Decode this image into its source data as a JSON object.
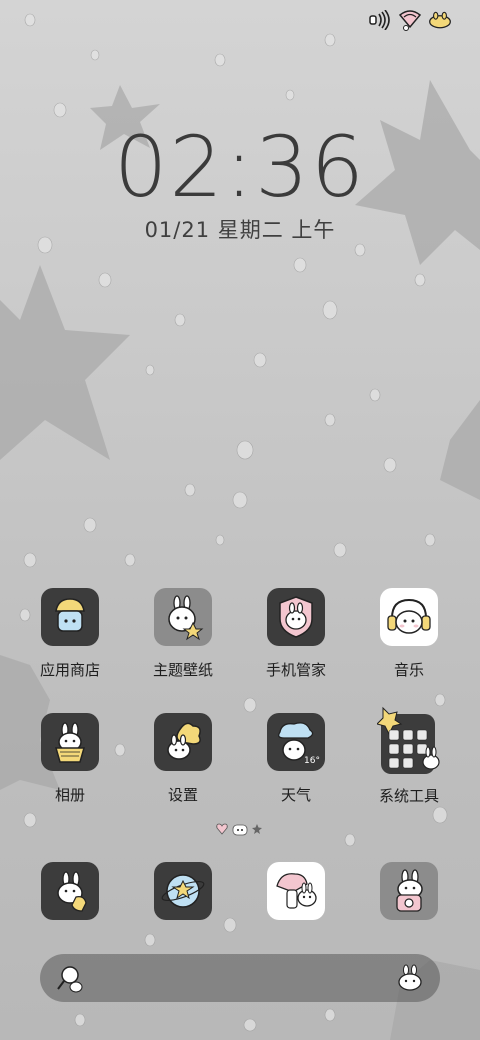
{
  "status_bar": {
    "icons": [
      "sound-wave-icon",
      "wifi-icon",
      "bunny-battery-icon"
    ]
  },
  "lockscreen": {
    "time": "02:36",
    "date": "01/21 星期二 上午"
  },
  "apps_row1": [
    {
      "label": "应用商店",
      "icon": "app-store-icon"
    },
    {
      "label": "主题壁纸",
      "icon": "theme-wallpaper-icon"
    },
    {
      "label": "手机管家",
      "icon": "phone-manager-icon"
    },
    {
      "label": "音乐",
      "icon": "music-icon"
    }
  ],
  "apps_row2": [
    {
      "label": "相册",
      "icon": "album-icon"
    },
    {
      "label": "设置",
      "icon": "settings-icon"
    },
    {
      "label": "天气",
      "icon": "weather-icon",
      "badge": "16°"
    },
    {
      "label": "系统工具",
      "icon": "system-tools-folder-icon"
    }
  ],
  "dock": [
    {
      "icon": "phone-icon"
    },
    {
      "icon": "browser-icon"
    },
    {
      "icon": "messages-icon"
    },
    {
      "icon": "camera-icon"
    }
  ],
  "colors": {
    "icon_dark": "#3c3c3c",
    "icon_mid": "#8c8c8c",
    "icon_light": "#ffffff",
    "text": "#1e1e1e"
  }
}
